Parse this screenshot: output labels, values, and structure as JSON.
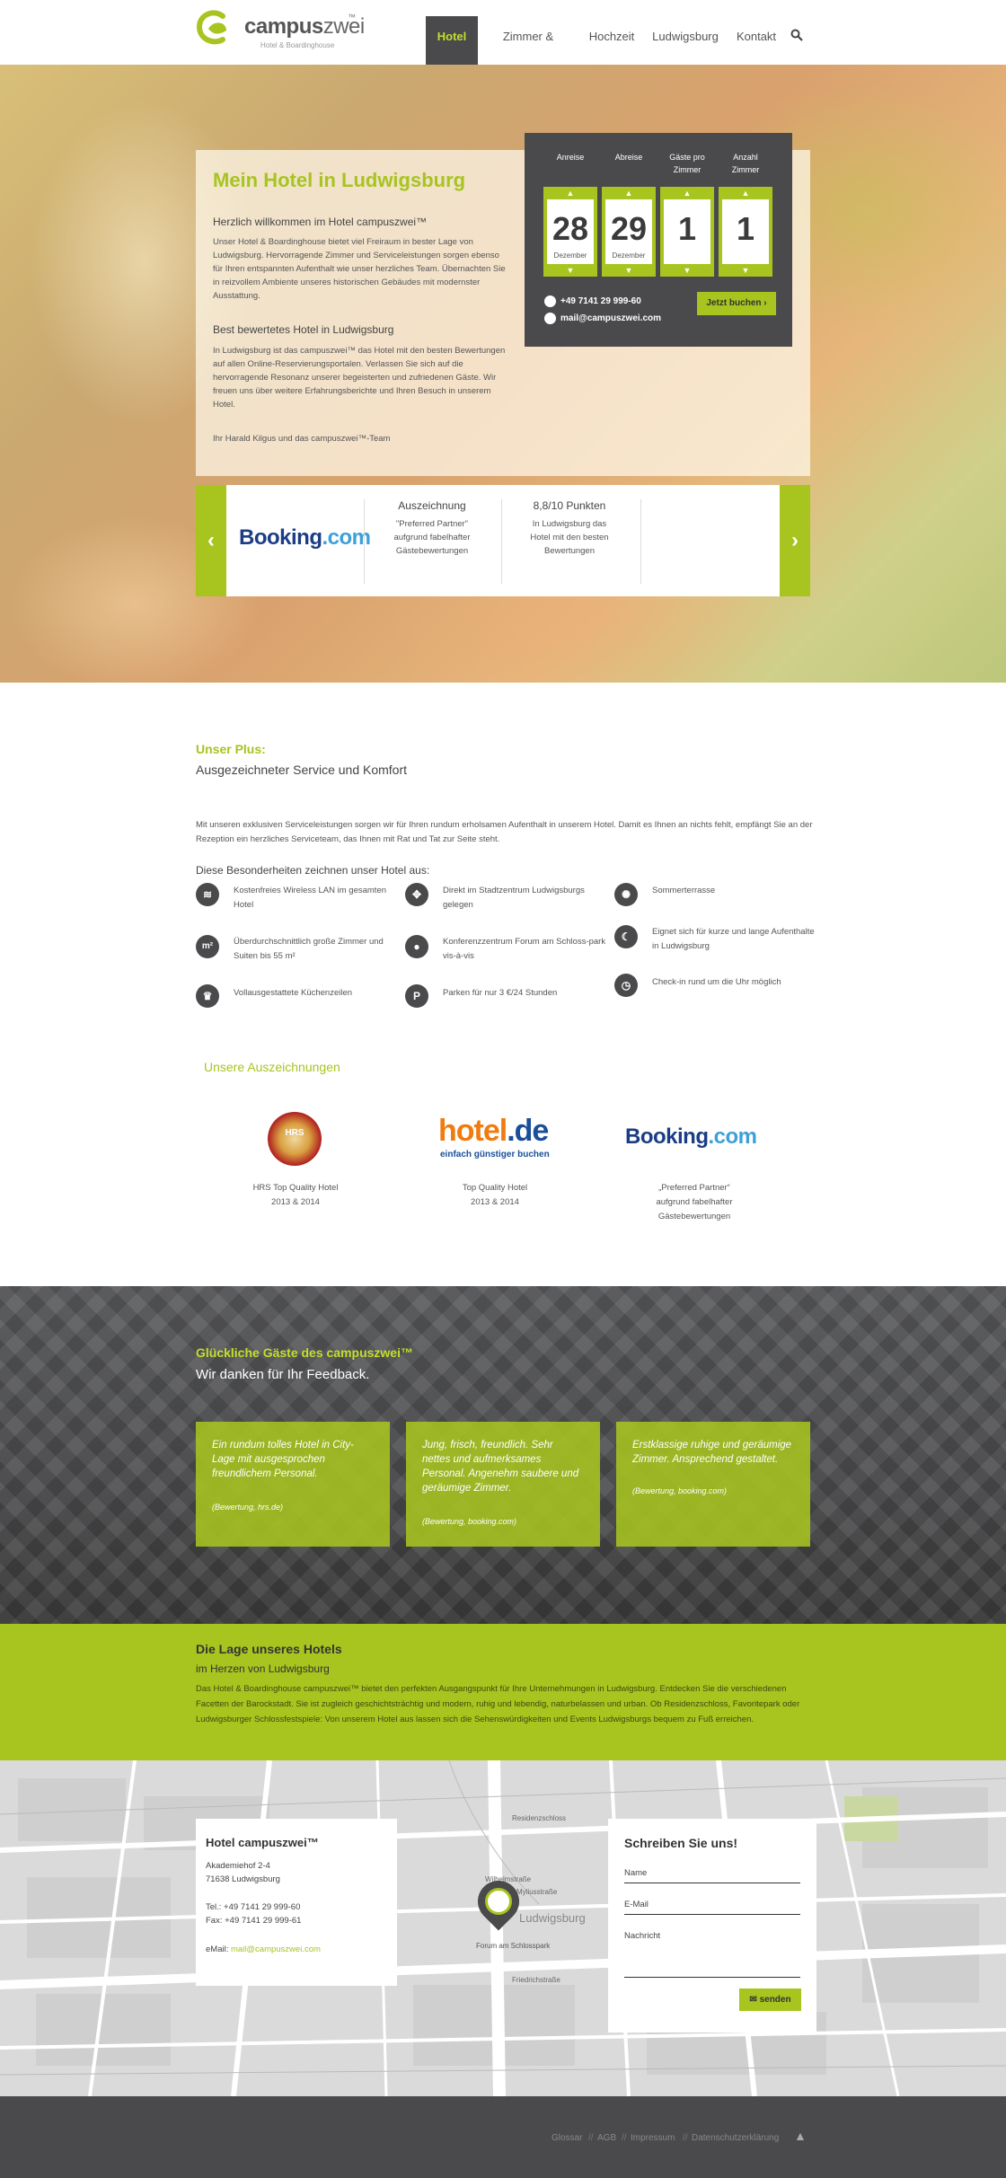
{
  "header": {
    "logo": {
      "name": "campus",
      "suffix": "zwei",
      "tm": "™",
      "subtitle": "Hotel & Boardinghouse"
    },
    "nav": [
      {
        "label": "Hotel",
        "active": true
      },
      {
        "label": "Zimmer & Preise"
      },
      {
        "label": "Hochzeit"
      },
      {
        "label": "Ludwigsburg"
      },
      {
        "label": "Kontakt"
      }
    ],
    "search_icon": "search-icon"
  },
  "welcome": {
    "title": "Mein Hotel in Ludwigsburg",
    "heading1": "Herzlich willkommen im Hotel campuszwei™",
    "text1": "Unser Hotel & Boardinghouse bietet viel Freiraum in bester Lage von Ludwigsburg. Hervorragende Zimmer und Serviceleistungen sorgen ebenso für Ihren entspannten Aufenthalt wie unser herzliches Team. Übernachten Sie in reizvollem Ambiente unseres historischen Gebäudes mit modernster Ausstattung.",
    "heading2": "Best bewertetes Hotel in Ludwigsburg",
    "text2": "In Ludwigsburg ist das campuszwei™ das Hotel mit den besten Bewertungen auf allen Online-Reservierungsportalen. Verlassen Sie sich auf die hervorragende Resonanz unserer begeisterten und zufriedenen Gäste. Wir freuen uns über weitere Erfahrungsberichte und Ihren Besuch in unserem Hotel.",
    "signature": "Ihr Harald Kilgus und das campuszwei™-Team"
  },
  "booking": {
    "fields": [
      {
        "label": "Anreise",
        "value": "28",
        "sub": "Dezember"
      },
      {
        "label": "Abreise",
        "value": "29",
        "sub": "Dezember"
      },
      {
        "label": "Gäste pro Zimmer",
        "value": "1",
        "sub": ""
      },
      {
        "label": "Anzahl Zimmer",
        "value": "1",
        "sub": ""
      }
    ],
    "phone": "+49 7141 29 999-60",
    "email": "mail@campuszwei.com",
    "button": "Jetzt buchen"
  },
  "slider": {
    "logo_main": "Booking",
    "logo_dot": ".com",
    "items": [
      {
        "title": "Auszeichnung",
        "text": "\"Preferred Partner\" aufgrund fabelhafter Gästebewertungen"
      },
      {
        "title": "8,8/10 Punkten",
        "text": "In Ludwigsburg das Hotel mit den besten Bewertungen"
      }
    ]
  },
  "plus": {
    "title": "Unser Plus:",
    "subtitle": "Ausgezeichneter Service und Komfort",
    "text": "Mit unseren exklusiven Serviceleistungen sorgen wir für Ihren rundum erholsamen Aufenthalt in unserem Hotel. Damit es Ihnen an nichts fehlt, empfängt Sie an der Rezeption ein herzliches Serviceteam, das Ihnen mit Rat und Tat zur Seite steht.",
    "features_heading": "Diese Besonderheiten zeichnen unser Hotel aus:",
    "features": [
      {
        "icon": "wifi-icon",
        "glyph": "≋",
        "text": "Kostenfreies Wireless LAN im gesamten Hotel"
      },
      {
        "icon": "m2-icon",
        "glyph": "m²",
        "text": "Überdurchschnittlich große Zimmer und Suiten bis 55 m²"
      },
      {
        "icon": "chef-hat-icon",
        "glyph": "♛",
        "text": "Vollausgestattete Küchenzeilen"
      },
      {
        "icon": "compass-icon",
        "glyph": "✥",
        "text": "Direkt im Stadtzentrum Ludwigsburgs gelegen"
      },
      {
        "icon": "speech-bubble-icon",
        "glyph": "●",
        "text": "Konferenzzentrum Forum am Schloss-park vis-à-vis"
      },
      {
        "icon": "parking-icon",
        "glyph": "P",
        "text": "Parken für nur 3 €/24 Stunden"
      },
      {
        "icon": "sun-icon",
        "glyph": "✺",
        "text": "Sommerterrasse"
      },
      {
        "icon": "moon-icon",
        "glyph": "☾",
        "text": "Eignet sich für kurze und lange Aufenthalte in Ludwigsburg"
      },
      {
        "icon": "clock-icon",
        "glyph": "◷",
        "text": "Check-in rund um die Uhr möglich"
      }
    ]
  },
  "awards": {
    "title": "Unsere Auszeichnungen",
    "hrs_seal": "HRS",
    "hotelde_main": "hotel",
    "hotelde_suffix": ".de",
    "hotelde_slogan": "einfach günstiger buchen",
    "booking_main": "Booking",
    "booking_dot": ".com",
    "items": [
      {
        "line1": "HRS Top Quality Hotel",
        "line2": "2013 & 2014"
      },
      {
        "line1": "Top Quality Hotel",
        "line2": "2013 & 2014"
      },
      {
        "line1": "„Preferred Partner“",
        "line2": "aufgrund fabelhafter Gästebewertungen"
      }
    ]
  },
  "guests": {
    "title": "Glückliche Gäste des campuszwei™",
    "subtitle": "Wir danken für Ihr Feedback.",
    "reviews": [
      {
        "quote": "Ein rundum tolles Hotel in City-Lage mit ausgesprochen freundlichem Personal.",
        "source": "(Bewertung, hrs.de)"
      },
      {
        "quote": "Jung, frisch, freundlich. Sehr nettes und aufmerksames Personal. Angenehm saubere und geräumige Zimmer.",
        "source": "(Bewertung, booking.com)"
      },
      {
        "quote": "Erstklassige ruhige und geräumige Zimmer. Ansprechend gestaltet.",
        "source": "(Bewertung, booking.com)"
      }
    ]
  },
  "location": {
    "title": "Die Lage unseres Hotels",
    "subtitle": "im Herzen von Ludwigsburg",
    "text": "Das Hotel & Boardinghouse campuszwei™ bietet den perfekten Ausgangspunkt für Ihre Unternehmungen in Ludwigsburg. Entdecken Sie die verschiedenen Facetten der Barockstadt. Sie ist zugleich geschichtsträchtig und modern, ruhig und lebendig, naturbelassen und urban. Ob Residenzschloss, Favoritepark oder Ludwigsburger Schlossfestspiele: Von unserem Hotel aus lassen sich die Sehenswürdigkeiten und Events Ludwigsburgs bequem zu Fuß erreichen."
  },
  "address": {
    "name": "Hotel campuszwei™",
    "street": "Akademiehof 2-4",
    "city": "71638 Ludwigsburg",
    "tel": "Tel.: +49 7141 29 999-60",
    "fax": "Fax: +49 7141 29 999-61",
    "email_label": "eMail: ",
    "email": "mail@campuszwei.com"
  },
  "map": {
    "labels": [
      "Residenzschloss",
      "Ludwigsburg",
      "Forum am Schlosspark",
      "Wilhelmstraße",
      "Friedrichstraße",
      "Myliusstraße"
    ]
  },
  "contact": {
    "title": "Schreiben Sie uns!",
    "name_placeholder": "Name",
    "email_placeholder": "E-Mail",
    "message_placeholder": "Nachricht",
    "button": "senden"
  },
  "footer": {
    "links": [
      "Glossar",
      "AGB",
      "Impressum",
      "Datenschutzerklärung"
    ],
    "separator": "//",
    "up_icon": "arrow-up-icon"
  },
  "colors": {
    "accent": "#a7c41f",
    "dark": "#4a4a4c",
    "nav_active_text": "#c4de2c"
  }
}
